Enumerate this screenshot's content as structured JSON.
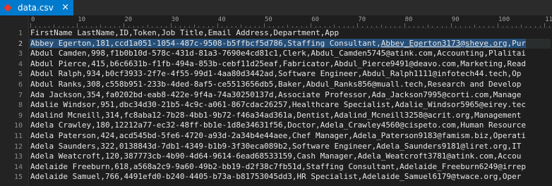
{
  "tab": {
    "filename": "data.csv",
    "close_glyph": "×"
  },
  "ruler": {
    "labels": [
      "0",
      "10",
      "20",
      "30",
      "40",
      "50",
      "60",
      "70",
      "80",
      "90",
      "100",
      "110"
    ]
  },
  "lines": [
    {
      "num": "1",
      "text": "FirstName LastName,ID,Token,Job Title,Email Address,Department,App"
    },
    {
      "num": "2",
      "pre": "Abbey Egerton,181,ccd1a051-1054-487c-9508-b5ffbcf5d786,Staffing Consultant,",
      "email": "Abbey_Egerton3173@sheye.org",
      "post": ",Pur"
    },
    {
      "num": "3",
      "text": "Abdul Camden,998,f1b0b10d-578c-431d-81a3-7690e4cd81c1,Clerk,Abdul_Camden5745@atink.com,Accounting,Plalitai"
    },
    {
      "num": "4",
      "text": "Abdul Pierce,415,b6c6631b-f1fb-494a-853b-cebf11d25eaf,Fabricator,Abdul_Pierce9491@deavo.com,Marketing,Read"
    },
    {
      "num": "5",
      "text": "Abdul Ralph,934,b0cf3933-2f7e-4f55-99d1-4aa80d3442ad,Software Engineer,Abdul_Ralph1111@infotech44.tech,Op"
    },
    {
      "num": "6",
      "text": "Abdul Ranks,308,c558b951-233b-4ded-8af5-ce5513656db5,Baker,Abdul_Ranks856@muall.tech,Research and Develop"
    },
    {
      "num": "7",
      "text": "Ada Jackson,354,fa0202bd-eab8-422e-9f4a-74a30250137d,Associate Professor,Ada_Jackson7995@corti.com,Manage"
    },
    {
      "num": "8",
      "text": "Adalie Windsor,951,dbc34d30-21b5-4c9c-a061-867cdac26257,Healthcare Specialist,Adalie_Windsor5965@eirey.tec"
    },
    {
      "num": "9",
      "text": "Adalind Mcneill,314,fc8aba12-7b28-4bb1-9b72-f46a34ad361a,Dentist,Adalind_Mcneill3258@acrit.org,Management"
    },
    {
      "num": "10",
      "text": "Adela Crawley,180,12212a77-ec32-48ff-bb1e-1d8e34631f56,Doctor,Adela_Crawley4560@cispeto.com,Human Resource"
    },
    {
      "num": "11",
      "text": "Adela Paterson,424,acd545bd-5fe6-4720-a93d-2a34b4e44aee,Chef Manager,Adela_Paterson9183@famism.biz,Operati"
    },
    {
      "num": "12",
      "text": "Adela Saunders,322,0138843d-7db1-4349-b1b9-3f30eca089b2,Software Engineer,Adela_Saunders9181@liret.org,IT"
    },
    {
      "num": "13",
      "text": "Adela Weatcroft,120,387773cb-4b90-4d64-9614-6ead68533159,Cash Manager,Adela_Weatcroft3781@atink.com,Accou"
    },
    {
      "num": "14",
      "text": "Adelaide Freeburn,618,a568a2c9-9a60-49b2-bb19-d2f38c7fb51d,Staffing Consultant,Adelaide_Freeburn6249@irrep"
    },
    {
      "num": "15",
      "text": "Adelaide Samuel,766,4491efd0-b240-4405-b73a-b81753045dd3,HR Specialist,Adelaide_Samuel6179@twace.org,Oper"
    }
  ]
}
